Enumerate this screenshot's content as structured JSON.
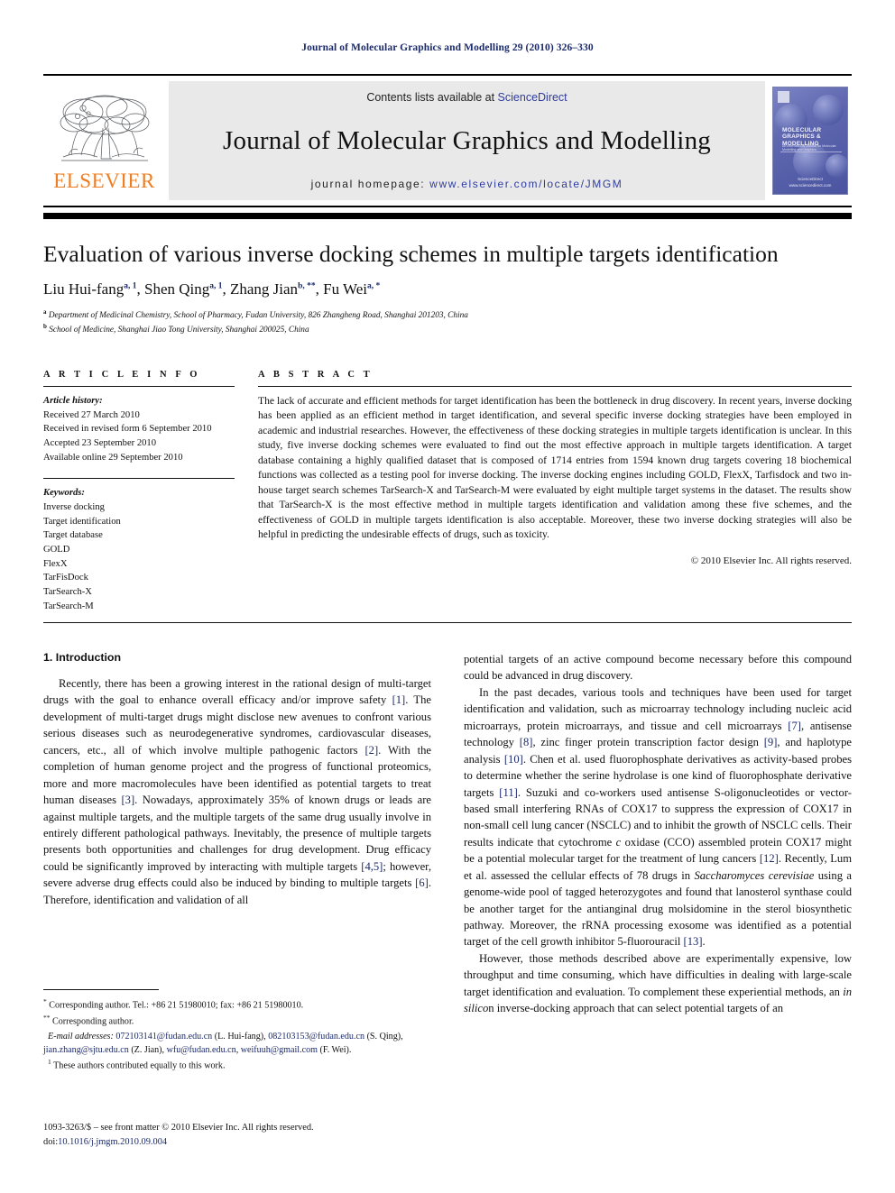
{
  "running_head": "Journal of Molecular Graphics and Modelling 29 (2010) 326–330",
  "masthead": {
    "publisher_name": "ELSEVIER",
    "contents_prefix": "Contents lists available at ",
    "contents_link": "ScienceDirect",
    "journal_title": "Journal of Molecular Graphics and Modelling",
    "homepage_prefix": "journal homepage: ",
    "homepage_url": "www.elsevier.com/locate/JMGM",
    "cover": {
      "title": "MOLECULAR GRAPHICS & MODELLING",
      "subtitle": "An International Journal for Molecular Modelling and Graphics",
      "footer_line1": "ScienceDirect",
      "footer_line2": "www.sciencedirect.com"
    }
  },
  "article": {
    "title": "Evaluation of various inverse docking schemes in multiple targets identification",
    "authors": [
      {
        "name": "Liu Hui-fang",
        "marks": "a, 1"
      },
      {
        "name": "Shen Qing",
        "marks": "a, 1"
      },
      {
        "name": "Zhang Jian",
        "marks": "b, **"
      },
      {
        "name": "Fu Wei",
        "marks": "a, *"
      }
    ],
    "affiliations": [
      {
        "mark": "a",
        "text": "Department of Medicinal Chemistry, School of Pharmacy, Fudan University, 826 Zhangheng Road, Shanghai 201203, China"
      },
      {
        "mark": "b",
        "text": "School of Medicine, Shanghai Jiao Tong University, Shanghai 200025, China"
      }
    ]
  },
  "article_info": {
    "heading": "A R T I C L E   I N F O",
    "history_label": "Article history:",
    "history": [
      "Received 27 March 2010",
      "Received in revised form 6 September 2010",
      "Accepted 23 September 2010",
      "Available online 29 September 2010"
    ],
    "keywords_label": "Keywords:",
    "keywords": [
      "Inverse docking",
      "Target identification",
      "Target database",
      "GOLD",
      "FlexX",
      "TarFisDock",
      "TarSearch-X",
      "TarSearch-M"
    ]
  },
  "abstract": {
    "heading": "A B S T R A C T",
    "text": "The lack of accurate and efficient methods for target identification has been the bottleneck in drug discovery. In recent years, inverse docking has been applied as an efficient method in target identification, and several specific inverse docking strategies have been employed in academic and industrial researches. However, the effectiveness of these docking strategies in multiple targets identification is unclear. In this study, five inverse docking schemes were evaluated to find out the most effective approach in multiple targets identification. A target database containing a highly qualified dataset that is composed of 1714 entries from 1594 known drug targets covering 18 biochemical functions was collected as a testing pool for inverse docking. The inverse docking engines including GOLD, FlexX, Tarfisdock and two in-house target search schemes TarSearch-X and TarSearch-M were evaluated by eight multiple target systems in the dataset. The results show that TarSearch-X is the most effective method in multiple targets identification and validation among these five schemes, and the effectiveness of GOLD in multiple targets identification is also acceptable. Moreover, these two inverse docking strategies will also be helpful in predicting the undesirable effects of drugs, such as toxicity.",
    "copyright": "© 2010 Elsevier Inc. All rights reserved."
  },
  "body": {
    "section_title": "1. Introduction",
    "left_paragraph_1_a": "Recently, there has been a growing interest in the rational design of multi-target drugs with the goal to enhance overall efficacy and/or improve safety ",
    "cite1": "[1]",
    "left_paragraph_1_b": ". The development of multi-target drugs might disclose new avenues to confront various serious diseases such as neurodegenerative syndromes, cardiovascular diseases, cancers, etc., all of which involve multiple pathogenic factors ",
    "cite2": "[2]",
    "left_paragraph_1_c": ". With the completion of human genome project and the progress of functional proteomics, more and more macromolecules have been identified as potential targets to treat human diseases ",
    "cite3": "[3]",
    "left_paragraph_1_d": ". Nowadays, approximately 35% of known drugs or leads are against multiple targets, and the multiple targets of the same drug usually involve in entirely different pathological pathways. Inevitably, the presence of multiple targets presents both opportunities and challenges for drug development. Drug efficacy could be significantly improved by interacting with multiple targets ",
    "cite45": "[4,5]",
    "left_paragraph_1_e": "; however, severe adverse drug effects could also be induced by binding to multiple targets ",
    "cite6": "[6]",
    "left_paragraph_1_f": ". Therefore, identification and validation of all",
    "right_paragraph_0": "potential targets of an active compound become necessary before this compound could be advanced in drug discovery.",
    "right_paragraph_1_a": "In the past decades, various tools and techniques have been used for target identification and validation, such as microarray technology including nucleic acid microarrays, protein microarrays, and tissue and cell microarrays ",
    "cite7": "[7]",
    "right_paragraph_1_b": ", antisense technology ",
    "cite8": "[8]",
    "right_paragraph_1_c": ", zinc finger protein transcription factor design ",
    "cite9": "[9]",
    "right_paragraph_1_d": ", and haplotype analysis ",
    "cite10": "[10]",
    "right_paragraph_1_e": ". Chen et al. used fluorophosphate derivatives as activity-based probes to determine whether the serine hydrolase is one kind of fluorophosphate derivative targets ",
    "cite11": "[11]",
    "right_paragraph_1_f": ". Suzuki and co-workers used antisense S-oligonucleotides or vector-based small interfering RNAs of COX17 to suppress the expression of COX17 in non-small cell lung cancer (NSCLC) and to inhibit the growth of NSCLC cells. Their results indicate that cytochrome ",
    "italic_c": "c",
    "right_paragraph_1_g": " oxidase (CCO) assembled protein COX17 might be a potential molecular target for the treatment of lung cancers ",
    "cite12": "[12]",
    "right_paragraph_1_h": ". Recently, Lum et al. assessed the cellular effects of 78 drugs in ",
    "italic_species": "Saccharomyces cerevisiae",
    "right_paragraph_1_i": " using a genome-wide pool of tagged heterozygotes and found that lanosterol synthase could be another target for the antianginal drug molsidomine in the sterol biosynthetic pathway. Moreover, the rRNA processing exosome was identified as a potential target of the cell growth inhibitor 5-fluorouracil ",
    "cite13": "[13]",
    "right_paragraph_1_j": ".",
    "right_paragraph_2_a": "However, those methods described above are experimentally expensive, low throughput and time consuming, which have difficulties in dealing with large-scale target identification and evaluation. To complement these experiential methods, an ",
    "italic_insilico": "in silico",
    "right_paragraph_2_b": "n inverse-docking approach that can select potential targets of an"
  },
  "footnotes": {
    "corr1_mark": "*",
    "corr1": " Corresponding author. Tel.: +86 21 51980010; fax: +86 21 51980010.",
    "corr2_mark": "**",
    "corr2": " Corresponding author.",
    "email_label": "E-mail addresses:",
    "email1": "072103141@fudan.edu.cn",
    "email1_who": " (L. Hui-fang), ",
    "email2": "082103153@fudan.edu.cn",
    "email2_who": " (S. Qing), ",
    "email3": "jian.zhang@sjtu.edu.cn",
    "email3_who": " (Z. Jian), ",
    "email4": "wfu@fudan.edu.cn",
    "email4_sep": ", ",
    "email5": "weifuuh@gmail.com",
    "email5_who": " (F. Wei).",
    "equal_mark": "1",
    "equal_contrib": " These authors contributed equally to this work."
  },
  "imprint": {
    "line1": "1093-3263/$ – see front matter © 2010 Elsevier Inc. All rights reserved.",
    "doi_label": "doi:",
    "doi": "10.1016/j.jmgm.2010.09.004"
  },
  "colors": {
    "link_blue": "#1b2a6b",
    "elsevier_orange": "#ef7d22",
    "banner_gray": "#e9e9e9"
  }
}
